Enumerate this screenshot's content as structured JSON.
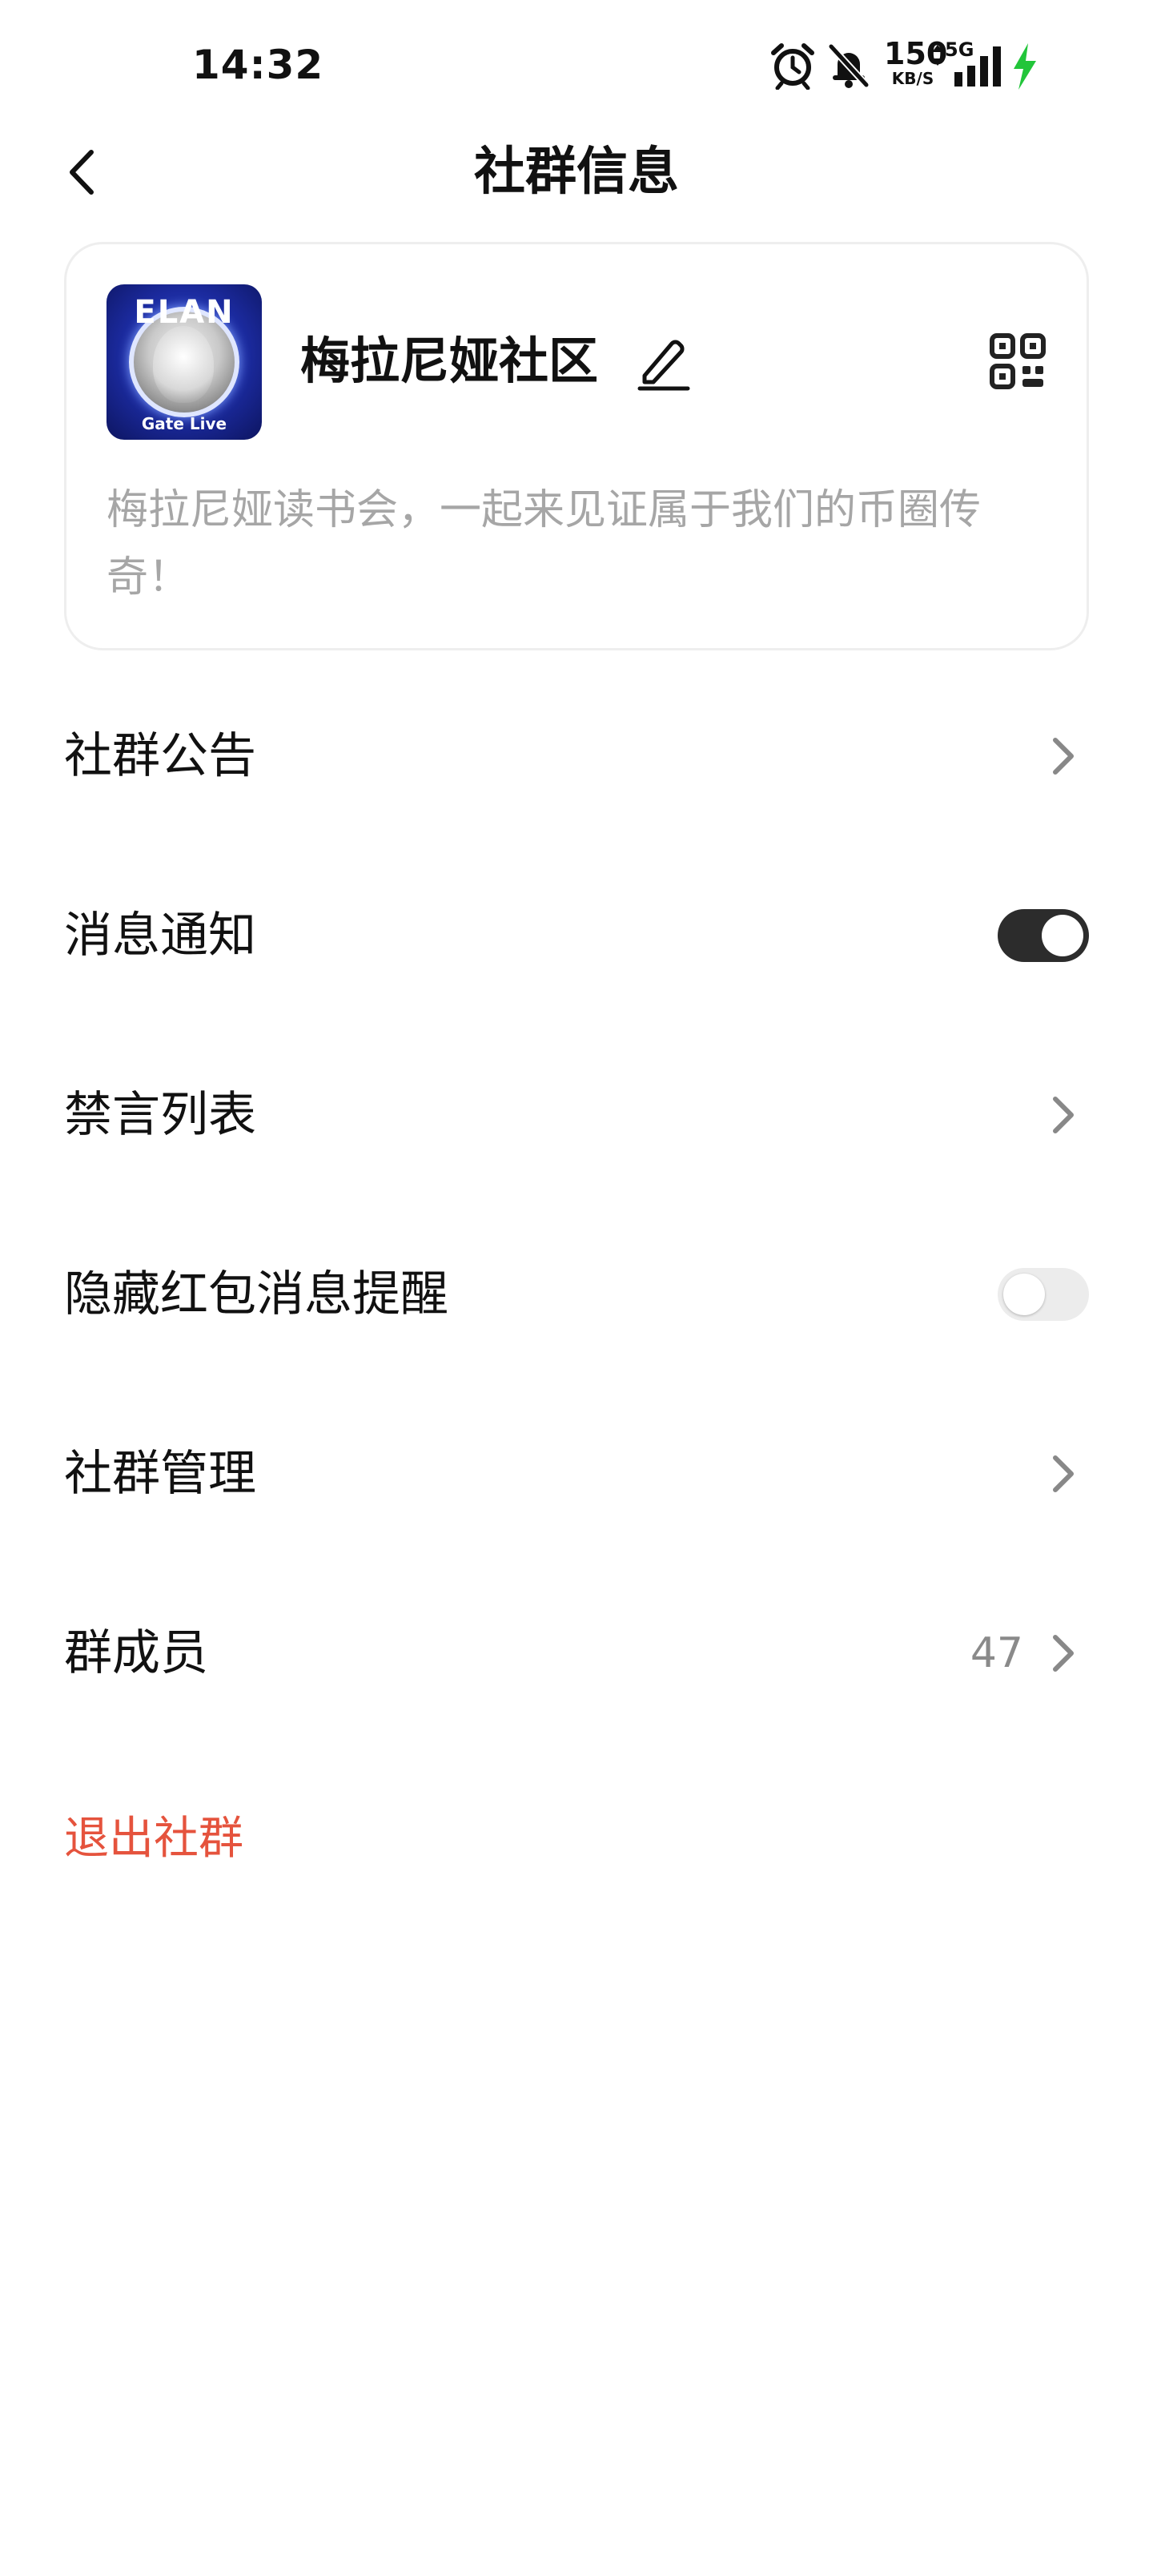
{
  "status_bar": {
    "time": "14:32",
    "network_speed": "150",
    "network_speed_unit": "KB/S",
    "network_type": "5G",
    "icons": [
      "alarm-icon",
      "mute-bell-icon",
      "network-speed",
      "data-arrows-icon",
      "signal-icon",
      "charging-icon"
    ],
    "charging_color": "#22c53a"
  },
  "header": {
    "title": "社群信息"
  },
  "community": {
    "name": "梅拉尼娅社区",
    "description": "梅拉尼娅读书会，一起来见证属于我们的币圈传奇！",
    "avatar_text_top": "ELAN",
    "avatar_caption": "Gate Live"
  },
  "menu": {
    "announcement": "社群公告",
    "notifications": {
      "label": "消息通知",
      "enabled": true
    },
    "mute_list": "禁言列表",
    "hide_red_packet": {
      "label": "隐藏红包消息提醒",
      "enabled": false
    },
    "management": "社群管理",
    "members": {
      "label": "群成员",
      "count": "47"
    },
    "exit": "退出社群"
  },
  "colors": {
    "accent_dark": "#2c2c2c",
    "exit_red": "#e5533d",
    "muted_text": "#a6a6a6"
  }
}
